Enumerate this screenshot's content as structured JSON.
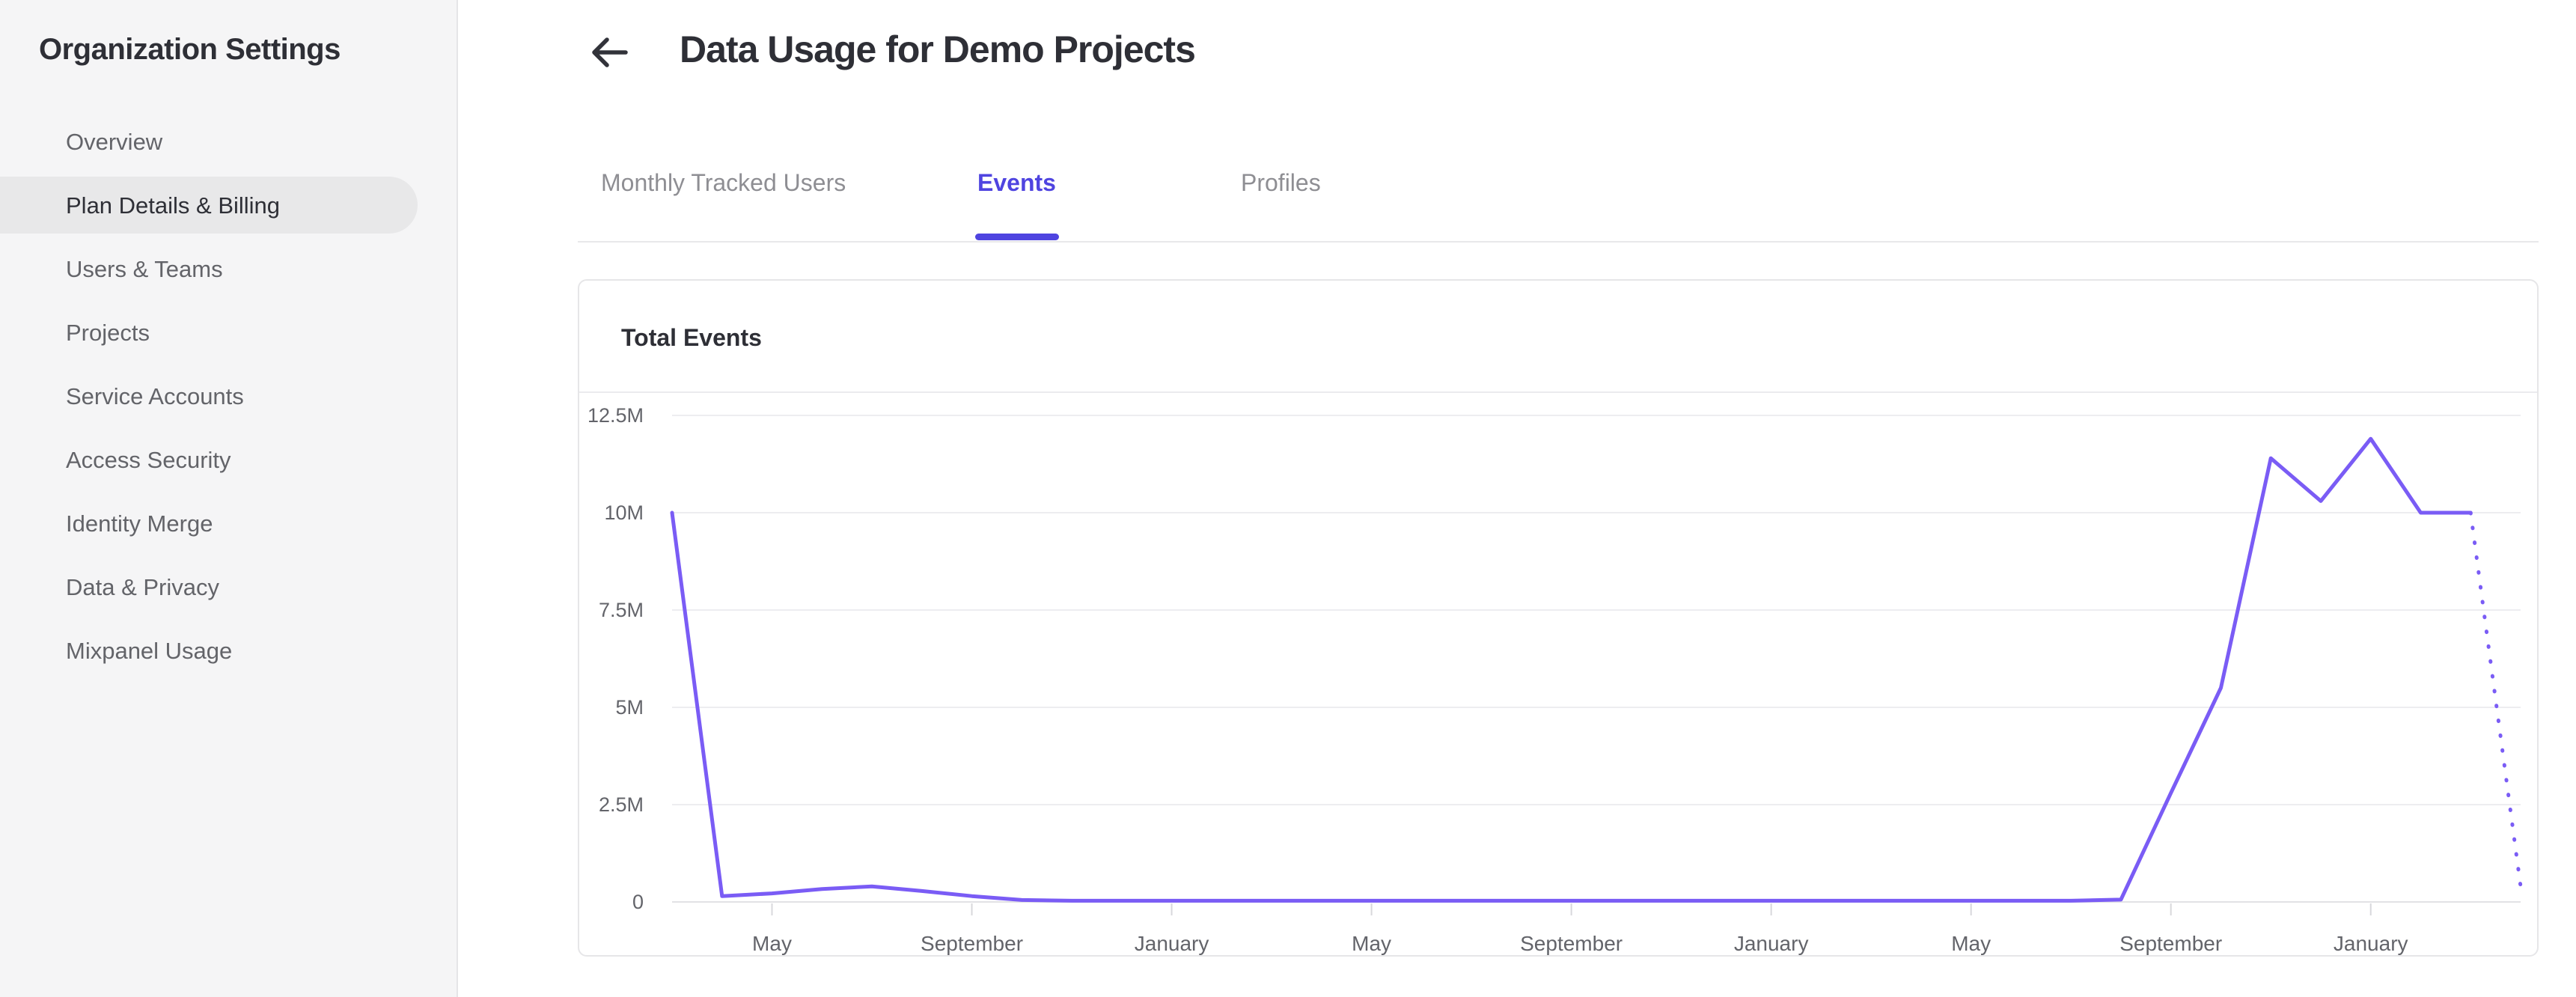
{
  "sidebar": {
    "title": "Organization Settings",
    "items": [
      {
        "label": "Overview",
        "active": false
      },
      {
        "label": "Plan Details & Billing",
        "active": true
      },
      {
        "label": "Users & Teams",
        "active": false
      },
      {
        "label": "Projects",
        "active": false
      },
      {
        "label": "Service Accounts",
        "active": false
      },
      {
        "label": "Access Security",
        "active": false
      },
      {
        "label": "Identity Merge",
        "active": false
      },
      {
        "label": "Data & Privacy",
        "active": false
      },
      {
        "label": "Mixpanel Usage",
        "active": false
      }
    ]
  },
  "header": {
    "back_icon": "left-arrow",
    "title": "Data Usage for Demo Projects"
  },
  "tabs": [
    {
      "label": "Monthly Tracked Users",
      "active": false
    },
    {
      "label": "Events",
      "active": true
    },
    {
      "label": "Profiles",
      "active": false
    }
  ],
  "card": {
    "title": "Total Events"
  },
  "chart_data": {
    "type": "line",
    "title": "Total Events",
    "ylim_millions": [
      0,
      12.5
    ],
    "y_tick_labels_top_to_bottom": [
      "12.5M",
      "10M",
      "7.5M",
      "5M",
      "2.5M",
      "0"
    ],
    "x_tick_labels": [
      "May",
      "September",
      "January",
      "May",
      "September",
      "January",
      "May",
      "September",
      "January"
    ],
    "x_tick_month_index": [
      2,
      6,
      10,
      14,
      18,
      22,
      26,
      30,
      34
    ],
    "x_range_months": 37,
    "grid": true,
    "legend": false,
    "line_color": "#7a5cf5",
    "series": [
      {
        "name": "Total Events (actual)",
        "style": "solid",
        "start_index": 0,
        "values_millions": [
          10,
          0.15,
          0.22,
          0.33,
          0.4,
          0.28,
          0.15,
          0.05,
          0.03,
          0.03,
          0.03,
          0.03,
          0.03,
          0.03,
          0.03,
          0.03,
          0.03,
          0.03,
          0.03,
          0.03,
          0.03,
          0.03,
          0.03,
          0.03,
          0.03,
          0.03,
          0.03,
          0.03,
          0.03,
          0.06,
          2.8,
          5.5,
          11.4,
          10.3,
          11.9,
          10.0,
          10.0
        ]
      },
      {
        "name": "Total Events (projected)",
        "style": "dotted",
        "start_index": 36,
        "values_millions": [
          10.0,
          0.4
        ]
      }
    ]
  },
  "colors": {
    "sidebar_bg": "#f5f5f6",
    "sidebar_pill": "#e8e8e9",
    "text_dark": "#2e2f36",
    "text_gray": "#636469",
    "tab_inactive": "#8e8e93",
    "accent_indigo": "#4f44e0",
    "line_purple": "#7a5cf5",
    "gridline": "#ededf0",
    "axis_line": "#e2e2e5",
    "axis_label": "#63646a",
    "card_border": "#e6e6e8"
  }
}
